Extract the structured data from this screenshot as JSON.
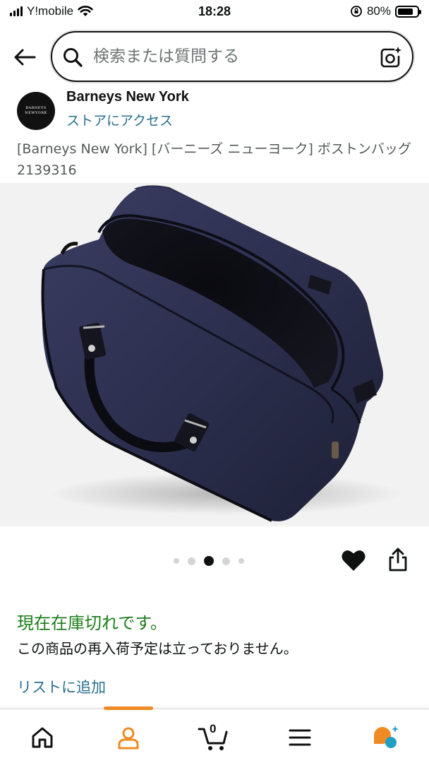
{
  "status_bar": {
    "carrier": "Y!mobile",
    "time": "18:28",
    "battery_percent": "80%",
    "battery_level": 0.8
  },
  "search": {
    "placeholder": "検索または質問する",
    "value": ""
  },
  "brand": {
    "name": "Barneys New York",
    "logo_line1": "BARNEYS",
    "logo_line2": "NEWYORK",
    "store_link": "ストアにアクセス"
  },
  "product": {
    "title": "[Barneys New York] [バーニーズ ニューヨーク] ボストンバッグ 2139316",
    "image_alt": "navy boston bag",
    "image_count": 5,
    "active_image_index": 2
  },
  "availability": {
    "status": "現在在庫切れです。",
    "restock": "この商品の再入荷予定は立っておりません。"
  },
  "actions": {
    "add_to_list": "リストに追加"
  },
  "bottom_nav": {
    "active": "account",
    "cart_count": "0",
    "items": [
      "home-icon",
      "account-icon",
      "cart-icon",
      "menu-icon",
      "rufus-icon"
    ]
  },
  "colors": {
    "link": "#2a6f8f",
    "in_stock_green": "#1f7d1b",
    "accent_orange": "#f08a24",
    "bag_navy": "#2c2f4e"
  }
}
